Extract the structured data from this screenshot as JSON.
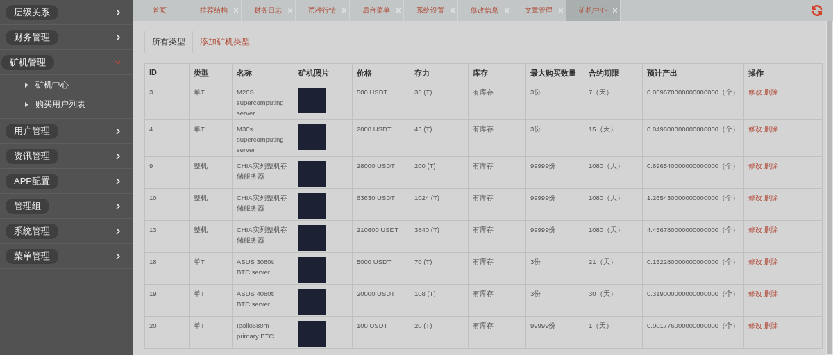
{
  "sidebar": {
    "items": [
      {
        "label": "层级关系",
        "expanded": false
      },
      {
        "label": "财务管理",
        "expanded": false
      },
      {
        "label": "矿机管理",
        "expanded": true,
        "children": [
          {
            "label": "矿机中心"
          },
          {
            "label": "购买用户列表"
          }
        ]
      },
      {
        "label": "用户管理",
        "expanded": false
      },
      {
        "label": "资讯管理",
        "expanded": false
      },
      {
        "label": "APP配置",
        "expanded": false
      },
      {
        "label": "管理组",
        "expanded": false
      },
      {
        "label": "系统管理",
        "expanded": false
      },
      {
        "label": "菜单管理",
        "expanded": false
      }
    ]
  },
  "tabs": [
    {
      "label": "首页",
      "selected": false,
      "closable": false
    },
    {
      "label": "推荐结构",
      "selected": false,
      "closable": true
    },
    {
      "label": "财务日志",
      "selected": false,
      "closable": true
    },
    {
      "label": "币种行情",
      "selected": false,
      "closable": true
    },
    {
      "label": "后台菜单",
      "selected": false,
      "closable": true
    },
    {
      "label": "系统设置",
      "selected": false,
      "closable": true
    },
    {
      "label": "修改信息",
      "selected": false,
      "closable": true
    },
    {
      "label": "文章管理",
      "selected": false,
      "closable": true
    },
    {
      "label": "矿机中心",
      "selected": true,
      "closable": true
    }
  ],
  "sub_tabs": [
    {
      "label": "所有类型",
      "selected": true
    },
    {
      "label": "添加矿机类型",
      "selected": false
    }
  ],
  "table": {
    "columns": [
      "ID",
      "类型",
      "名称",
      "矿机照片",
      "价格",
      "存力",
      "库存",
      "最大购买数量",
      "合约期限",
      "预计产出",
      "操作"
    ],
    "rows": [
      {
        "id": "3",
        "type": "单T",
        "name": "M20S supercomputing server",
        "price": "500   USDT",
        "power": "35   (T)",
        "stock": "有库存",
        "max": "3份",
        "term": "7（天）",
        "output": "0.009670000000000000（个）",
        "actions": [
          "修改",
          "删除"
        ]
      },
      {
        "id": "4",
        "type": "单T",
        "name": "M30s supercomputing server",
        "price": "2000   USDT",
        "power": "45   (T)",
        "stock": "有库存",
        "max": "3份",
        "term": "15（天）",
        "output": "0.049600000000000000（个）",
        "actions": [
          "修改",
          "删除"
        ]
      },
      {
        "id": "9",
        "type": "整机",
        "name": "CHIA实列整机存储服务器",
        "price": "28000   USDT",
        "power": "200   (T)",
        "stock": "有库存",
        "max": "99999份",
        "term": "1080（天）",
        "output": "0.896540000000000000（个）",
        "actions": [
          "修改",
          "删除"
        ]
      },
      {
        "id": "10",
        "type": "整机",
        "name": "CHIA实列整机存储服务器",
        "price": "63630   USDT",
        "power": "1024   (T)",
        "stock": "有库存",
        "max": "99999份",
        "term": "1080（天）",
        "output": "1.265430000000000000（个）",
        "actions": [
          "修改",
          "删除"
        ]
      },
      {
        "id": "13",
        "type": "整机",
        "name": "CHIA实列整机存储服务器",
        "price": "210600   USDT",
        "power": "3840   (T)",
        "stock": "有库存",
        "max": "99999份",
        "term": "1080（天）",
        "output": "4.456780000000000000（个）",
        "actions": [
          "修改",
          "删除"
        ]
      },
      {
        "id": "18",
        "type": "单T",
        "name": "ASUS 3080ti BTC server",
        "price": "5000   USDT",
        "power": "70   (T)",
        "stock": "有库存",
        "max": "3份",
        "term": "21（天）",
        "output": "0.152280000000000000（个）",
        "actions": [
          "修改",
          "删除"
        ]
      },
      {
        "id": "19",
        "type": "单T",
        "name": "ASUS 4080ti BTC server",
        "price": "20000   USDT",
        "power": "108   (T)",
        "stock": "有库存",
        "max": "3份",
        "term": "30（天）",
        "output": "0.319000000000000000（个）",
        "actions": [
          "修改",
          "删除"
        ]
      },
      {
        "id": "20",
        "type": "单T",
        "name": "Ipollo680m primary BTC",
        "price": "100   USDT",
        "power": "20   (T)",
        "stock": "有库存",
        "max": "99999份",
        "term": "1（天）",
        "output": "0.001776000000000000（个）",
        "actions": [
          "修改",
          "删除"
        ]
      }
    ]
  }
}
